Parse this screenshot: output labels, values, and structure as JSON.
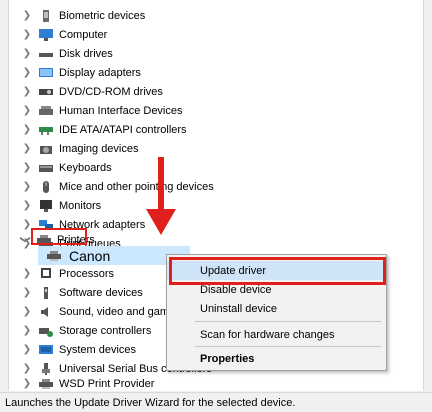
{
  "tree": {
    "items": [
      {
        "label": "Biometric devices",
        "icon": "biometric-icon"
      },
      {
        "label": "Computer",
        "icon": "computer-icon"
      },
      {
        "label": "Disk drives",
        "icon": "disk-drive-icon"
      },
      {
        "label": "Display adapters",
        "icon": "display-adapter-icon"
      },
      {
        "label": "DVD/CD-ROM drives",
        "icon": "dvd-drive-icon"
      },
      {
        "label": "Human Interface Devices",
        "icon": "hid-icon"
      },
      {
        "label": "IDE ATA/ATAPI controllers",
        "icon": "ide-controller-icon"
      },
      {
        "label": "Imaging devices",
        "icon": "camera-icon"
      },
      {
        "label": "Keyboards",
        "icon": "keyboard-icon"
      },
      {
        "label": "Mice and other pointing devices",
        "icon": "mouse-icon"
      },
      {
        "label": "Monitors",
        "icon": "monitor-icon"
      },
      {
        "label": "Network adapters",
        "icon": "network-adapter-icon"
      },
      {
        "label": "Print queues",
        "icon": "print-queue-icon"
      },
      {
        "label": "Printers",
        "icon": "printer-icon"
      },
      {
        "label": "Processors",
        "icon": "processor-icon"
      },
      {
        "label": "Software devices",
        "icon": "software-device-icon"
      },
      {
        "label": "Sound, video and game controllers",
        "icon": "speaker-icon"
      },
      {
        "label": "Storage controllers",
        "icon": "storage-controller-icon"
      },
      {
        "label": "System devices",
        "icon": "system-device-icon"
      },
      {
        "label": "Universal Serial Bus controllers",
        "icon": "usb-icon"
      },
      {
        "label": "WSD Print Provider",
        "icon": "printer-icon"
      }
    ],
    "expanded_child": {
      "label": "Canon",
      "icon": "printer-icon"
    }
  },
  "context_menu": {
    "items": [
      {
        "label": "Update driver",
        "active": true
      },
      {
        "label": "Disable device"
      },
      {
        "label": "Uninstall device"
      },
      {
        "label": "Scan for hardware changes"
      },
      {
        "label": "Properties",
        "bold": true
      }
    ]
  },
  "status_bar": {
    "text": "Launches the Update Driver Wizard for the selected device."
  },
  "annotations": {
    "highlight_color": "#e0201c",
    "arrow_color": "#e0201c"
  },
  "colors": {
    "selection": "#cce8ff",
    "menu_hover": "#cfe4f7"
  }
}
